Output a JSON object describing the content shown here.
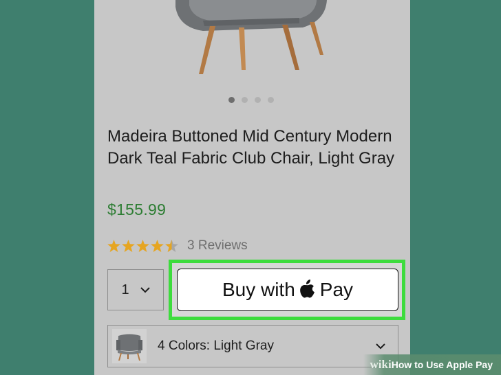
{
  "product": {
    "title": "Madeira Buttoned Mid Century Modern Dark Teal Fabric Club Chair, Light Gray",
    "price": "$155.99",
    "rating": 4.5,
    "reviews_label": "3 Reviews",
    "image_dots": 4,
    "active_dot": 1
  },
  "quantity": {
    "value": "1"
  },
  "buy_button": {
    "label_prefix": "Buy with",
    "label_suffix": "Pay"
  },
  "colors": {
    "label": "4 Colors:",
    "value": "Light Gray"
  },
  "watermark": {
    "brand": "wiki",
    "text": "How to Use Apple Pay"
  },
  "colors_theme": {
    "background": "#3f7f6e",
    "price": "#2d7d33",
    "highlight": "#3ddc3d",
    "star": "#e6a521"
  },
  "icons": {
    "dropdown": "chevron-down-icon",
    "apple": "apple-logo-icon",
    "star": "star-icon"
  }
}
